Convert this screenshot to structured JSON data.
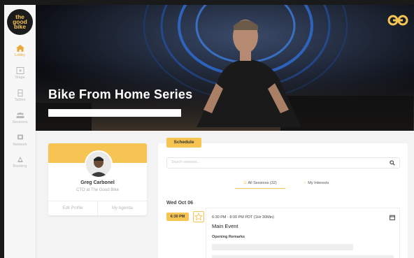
{
  "brand": {
    "logo_lines": [
      "the",
      "good",
      "bike"
    ],
    "accent": "#f5c453"
  },
  "sidebar": {
    "items": [
      {
        "label": "Lobby",
        "icon": "home-icon",
        "active": true
      },
      {
        "label": "Stage",
        "icon": "play-icon",
        "active": false
      },
      {
        "label": "Tables",
        "icon": "tables-icon",
        "active": false
      },
      {
        "label": "Sessions",
        "icon": "people-icon",
        "active": false
      },
      {
        "label": "Network",
        "icon": "network-icon",
        "active": false
      },
      {
        "label": "Booking",
        "icon": "booking-icon",
        "active": false
      }
    ]
  },
  "hero": {
    "title": "Bike From Home Series"
  },
  "profile": {
    "name": "Greg Carbonel",
    "role": "CTO at The Good Bike",
    "edit_label": "Edit Profile",
    "agenda_label": "My Agenda"
  },
  "schedule": {
    "tab_label": "Schedule",
    "search_placeholder": "Search sessions...",
    "filters": {
      "all": "All Sessions (32)",
      "interests": "My Interests"
    },
    "date": "Wed Oct 06",
    "event": {
      "time_badge": "6:30 PM",
      "time_range": "6:30 PM - 8:00 PM PDT (1Hr 30Min)",
      "title": "Main Event",
      "subtitle": "Opening Remarks"
    }
  }
}
